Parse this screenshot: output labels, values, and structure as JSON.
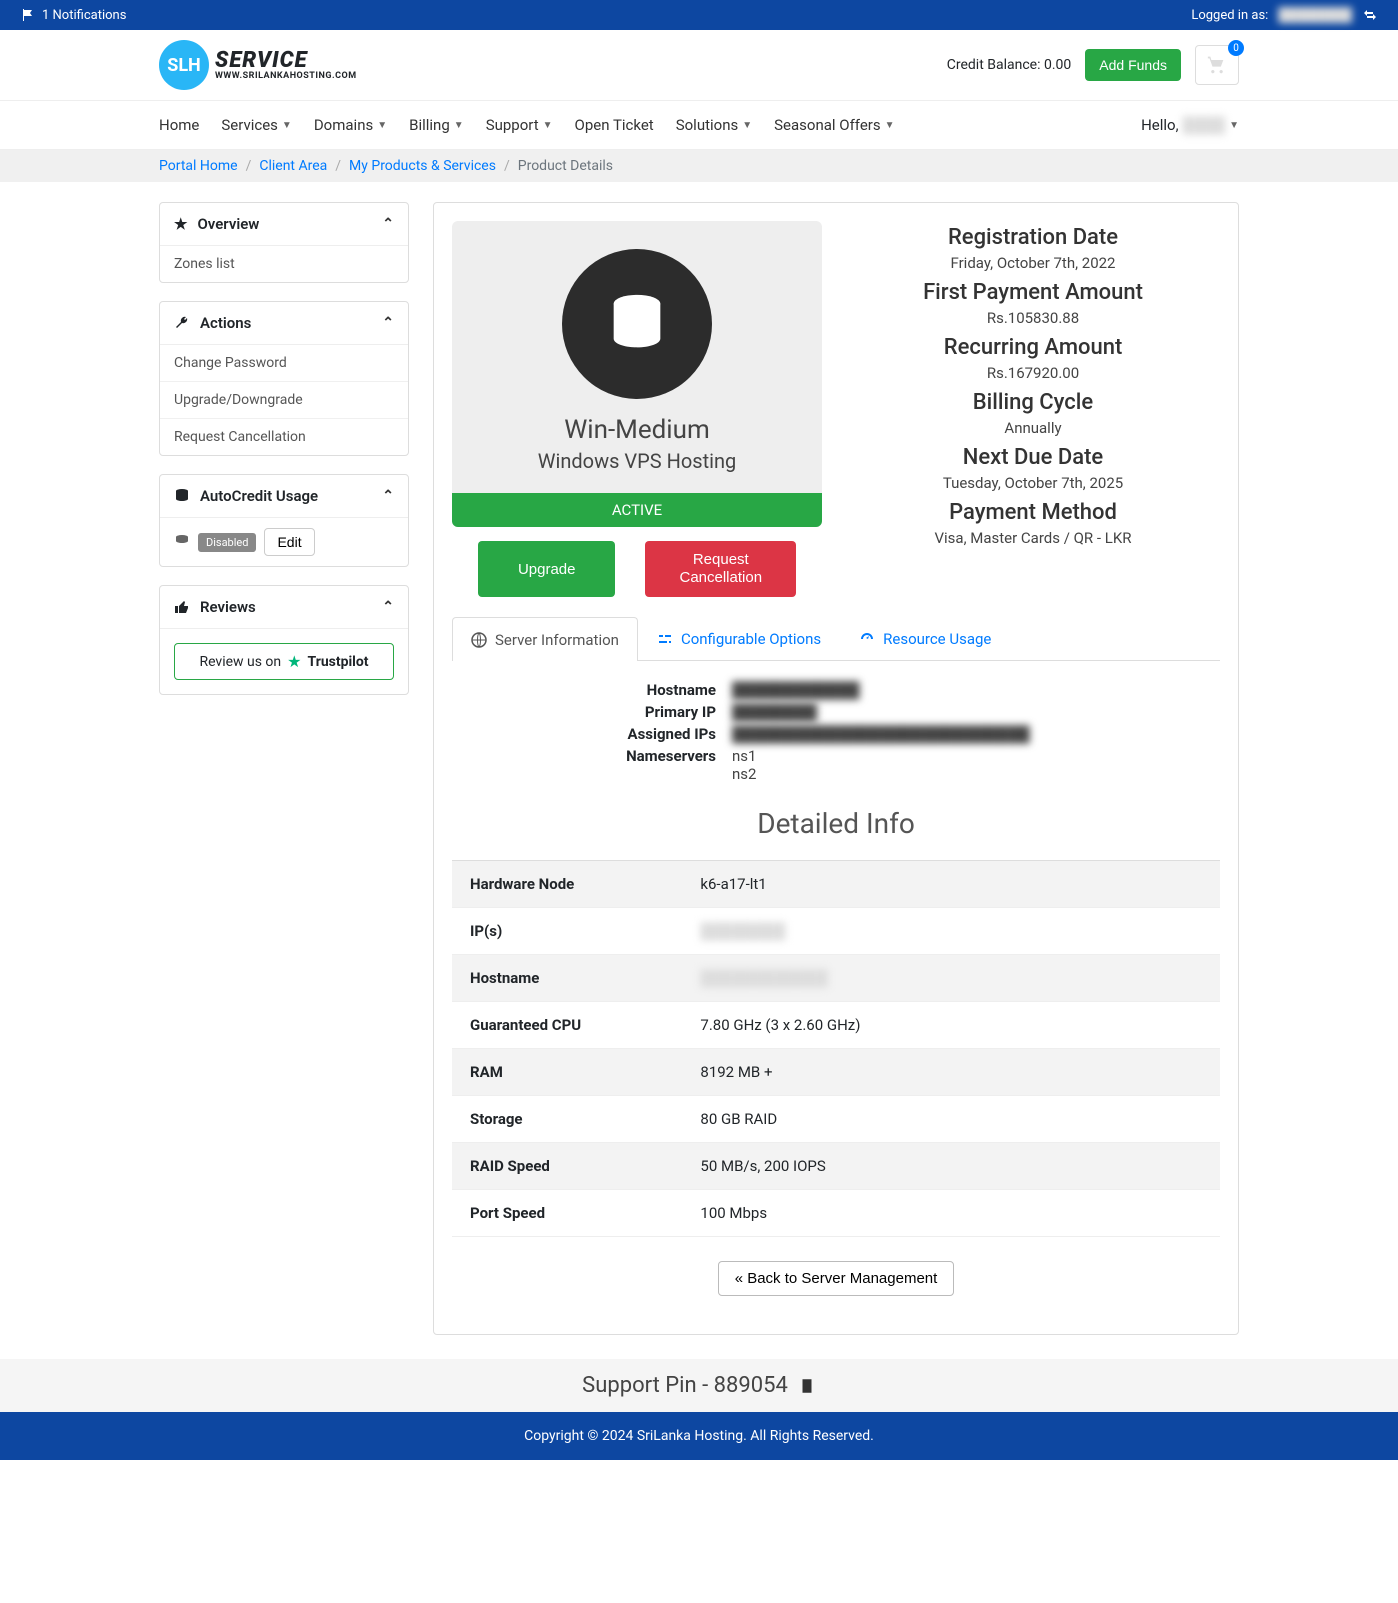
{
  "topbar": {
    "notifications": "1 Notifications",
    "logged_in_as": "Logged in as:",
    "masked_user": "████████"
  },
  "header": {
    "logo_service": "SERVICE",
    "logo_sub": "WWW.SRILANKAHOSTING.COM",
    "credit_balance": "Credit Balance: 0.00",
    "add_funds": "Add Funds",
    "cart_count": "0"
  },
  "nav": {
    "items": [
      "Home",
      "Services",
      "Domains",
      "Billing",
      "Support",
      "Open Ticket",
      "Solutions",
      "Seasonal Offers"
    ],
    "hello": "Hello,",
    "user": "████"
  },
  "breadcrumb": {
    "portal_home": "Portal Home",
    "client_area": "Client Area",
    "my_products": "My Products & Services",
    "product_details": "Product Details"
  },
  "sidebar": {
    "overview": {
      "title": "Overview",
      "items": [
        "Zones list"
      ]
    },
    "actions": {
      "title": "Actions",
      "items": [
        "Change Password",
        "Upgrade/Downgrade",
        "Request Cancellation"
      ]
    },
    "autocredit": {
      "title": "AutoCredit Usage",
      "status": "Disabled",
      "edit": "Edit"
    },
    "reviews": {
      "title": "Reviews",
      "cta": "Review us on",
      "brand": "Trustpilot"
    }
  },
  "product": {
    "name": "Win-Medium",
    "category": "Windows VPS Hosting",
    "status": "ACTIVE",
    "upgrade": "Upgrade",
    "cancel": "Request Cancellation"
  },
  "details": {
    "reg_date_label": "Registration Date",
    "reg_date": "Friday, October 7th, 2022",
    "first_pay_label": "First Payment Amount",
    "first_pay": "Rs.105830.88",
    "recurring_label": "Recurring Amount",
    "recurring": "Rs.167920.00",
    "cycle_label": "Billing Cycle",
    "cycle": "Annually",
    "due_label": "Next Due Date",
    "due": "Tuesday, October 7th, 2025",
    "method_label": "Payment Method",
    "method": "Visa, Master Cards / QR - LKR"
  },
  "tabs": {
    "server_info": "Server Information",
    "configurable": "Configurable Options",
    "resource": "Resource Usage"
  },
  "server_info": {
    "hostname_label": "Hostname",
    "hostname": "████████████",
    "primary_ip_label": "Primary IP",
    "primary_ip": "████████",
    "assigned_ips_label": "Assigned IPs",
    "assigned_ips": "████████████████████████████",
    "nameservers_label": "Nameservers",
    "ns1": "ns1",
    "ns2": "ns2"
  },
  "detailed_info_title": "Detailed Info",
  "table": [
    {
      "label": "Hardware Node",
      "value": "k6-a17-lt1"
    },
    {
      "label": "IP(s)",
      "value": "████████",
      "blurred": true
    },
    {
      "label": "Hostname",
      "value": "████████████",
      "blurred": true
    },
    {
      "label": "Guaranteed CPU",
      "value": "7.80 GHz (3 x 2.60 GHz)"
    },
    {
      "label": "RAM",
      "value": "8192 MB +"
    },
    {
      "label": "Storage",
      "value": "80 GB RAID"
    },
    {
      "label": "RAID Speed",
      "value": "50 MB/s, 200 IOPS"
    },
    {
      "label": "Port Speed",
      "value": "100 Mbps"
    }
  ],
  "back_button": "« Back to Server Management",
  "support_pin": "Support Pin - 889054",
  "footer": "Copyright © 2024 SriLanka Hosting. All Rights Reserved."
}
